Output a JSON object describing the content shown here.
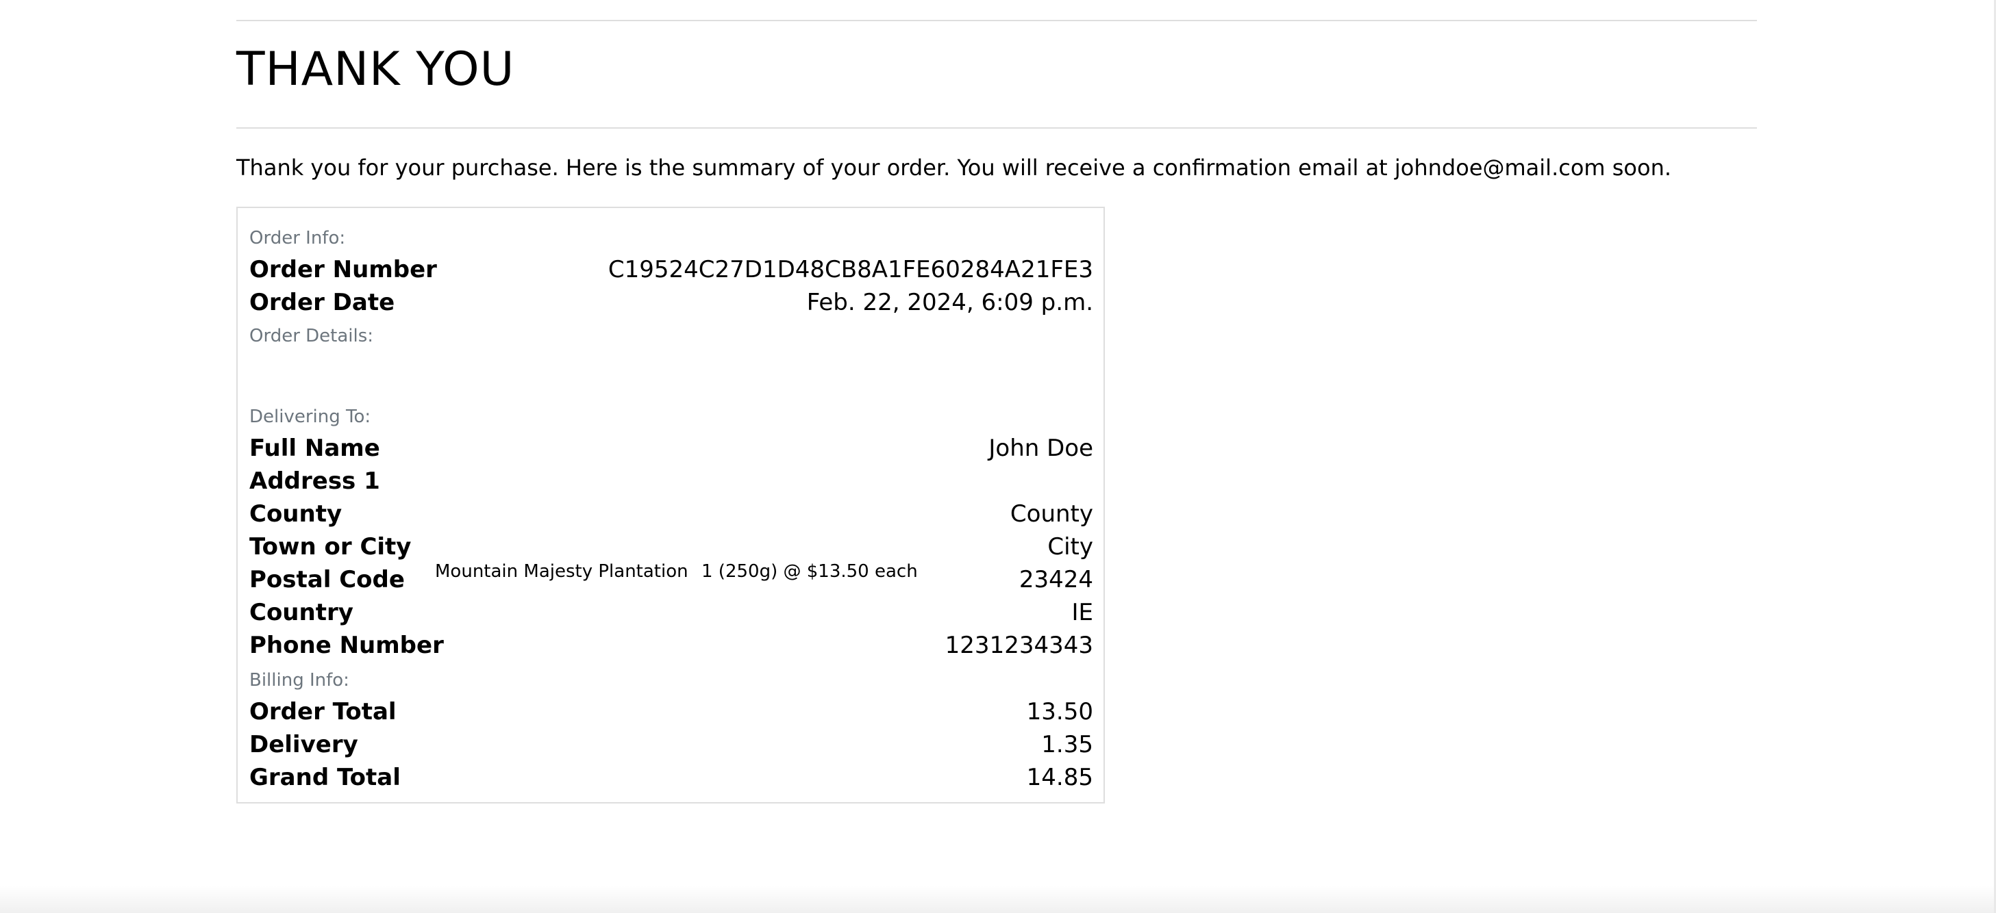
{
  "page": {
    "title": "THANK YOU",
    "intro": "Thank you for your purchase. Here is the summary of your order. You will receive a confirmation email at johndoe@mail.com soon."
  },
  "order_info": {
    "section_label": "Order Info:",
    "order_number_label": "Order Number",
    "order_number": "C19524C27D1D48CB8A1FE60284A21FE3",
    "order_date_label": "Order Date",
    "order_date": "Feb. 22, 2024, 6:09 p.m."
  },
  "order_details": {
    "section_label": "Order Details:",
    "items": [
      {
        "name": "Mountain Majesty Plantation",
        "quantity_text": "1 (250g) @ $13.50 each"
      }
    ]
  },
  "delivery": {
    "section_label": "Delivering To:",
    "full_name_label": "Full Name",
    "full_name": "John Doe",
    "address1_label": "Address 1",
    "address1": "",
    "county_label": "County",
    "county": "County",
    "town_label": "Town or City",
    "town": "City",
    "postal_label": "Postal Code",
    "postal": "23424",
    "country_label": "Country",
    "country": "IE",
    "phone_label": "Phone Number",
    "phone": "1231234343"
  },
  "billing": {
    "section_label": "Billing Info:",
    "order_total_label": "Order Total",
    "order_total": "13.50",
    "delivery_label": "Delivery",
    "delivery": "1.35",
    "grand_total_label": "Grand Total",
    "grand_total": "14.85"
  }
}
